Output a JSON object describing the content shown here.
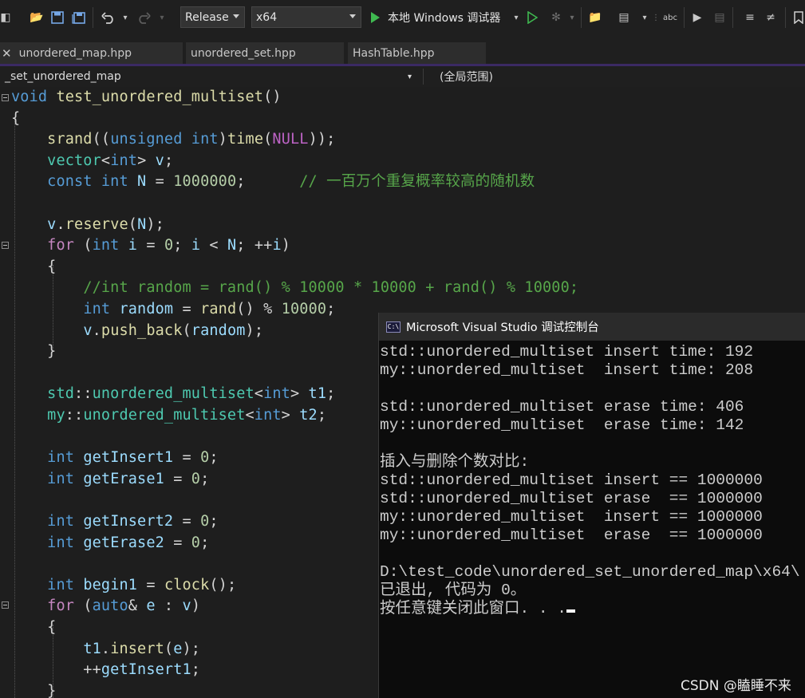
{
  "toolbar": {
    "config_value": "Release",
    "platform_value": "x64",
    "run_label": "本地 Windows 调试器"
  },
  "tabs": [
    "unordered_map.hpp",
    "unordered_set.hpp",
    "HashTable.hpp"
  ],
  "navbar": {
    "scope_left": "_set_unordered_map",
    "scope_right": "(全局范围)"
  },
  "code_lines": [
    [
      [
        "kw",
        "void"
      ],
      [
        "op",
        " "
      ],
      [
        "fn",
        "test_unordered_multiset"
      ],
      [
        "op",
        "()"
      ]
    ],
    [
      [
        "op",
        "{"
      ]
    ],
    [
      [
        "op",
        "    "
      ],
      [
        "fn",
        "srand"
      ],
      [
        "op",
        "(("
      ],
      [
        "kw",
        "unsigned int"
      ],
      [
        "op",
        ")"
      ],
      [
        "fn",
        "time"
      ],
      [
        "op",
        "("
      ],
      [
        "mac",
        "NULL"
      ],
      [
        "op",
        "));"
      ]
    ],
    [
      [
        "op",
        "    "
      ],
      [
        "ty",
        "vector"
      ],
      [
        "op",
        "<"
      ],
      [
        "kw",
        "int"
      ],
      [
        "op",
        "> "
      ],
      [
        "id",
        "v"
      ],
      [
        "op",
        ";"
      ]
    ],
    [
      [
        "op",
        "    "
      ],
      [
        "kw",
        "const int"
      ],
      [
        "op",
        " "
      ],
      [
        "id",
        "N"
      ],
      [
        "op",
        " = "
      ],
      [
        "num",
        "1000000"
      ],
      [
        "op",
        ";      "
      ],
      [
        "cm",
        "// 一百万个重复概率较高的随机数"
      ]
    ],
    [],
    [
      [
        "op",
        "    "
      ],
      [
        "id",
        "v"
      ],
      [
        "op",
        "."
      ],
      [
        "fn",
        "reserve"
      ],
      [
        "op",
        "("
      ],
      [
        "id",
        "N"
      ],
      [
        "op",
        ");"
      ]
    ],
    [
      [
        "op",
        "    "
      ],
      [
        "ctl",
        "for"
      ],
      [
        "op",
        " ("
      ],
      [
        "kw",
        "int"
      ],
      [
        "op",
        " "
      ],
      [
        "id",
        "i"
      ],
      [
        "op",
        " = "
      ],
      [
        "num",
        "0"
      ],
      [
        "op",
        "; "
      ],
      [
        "id",
        "i"
      ],
      [
        "op",
        " < "
      ],
      [
        "id",
        "N"
      ],
      [
        "op",
        "; ++"
      ],
      [
        "id",
        "i"
      ],
      [
        "op",
        ")"
      ]
    ],
    [
      [
        "op",
        "    {"
      ]
    ],
    [
      [
        "op",
        "        "
      ],
      [
        "cm",
        "//int random = rand() % 10000 * 10000 + rand() % 10000;"
      ]
    ],
    [
      [
        "op",
        "        "
      ],
      [
        "kw",
        "int"
      ],
      [
        "op",
        " "
      ],
      [
        "id",
        "random"
      ],
      [
        "op",
        " = "
      ],
      [
        "fn",
        "rand"
      ],
      [
        "op",
        "() % "
      ],
      [
        "num",
        "10000"
      ],
      [
        "op",
        ";"
      ]
    ],
    [
      [
        "op",
        "        "
      ],
      [
        "id",
        "v"
      ],
      [
        "op",
        "."
      ],
      [
        "fn",
        "push_back"
      ],
      [
        "op",
        "("
      ],
      [
        "id",
        "random"
      ],
      [
        "op",
        ");"
      ]
    ],
    [
      [
        "op",
        "    }"
      ]
    ],
    [],
    [
      [
        "op",
        "    "
      ],
      [
        "ty",
        "std"
      ],
      [
        "op",
        "::"
      ],
      [
        "ty",
        "unordered_multiset"
      ],
      [
        "op",
        "<"
      ],
      [
        "kw",
        "int"
      ],
      [
        "op",
        "> "
      ],
      [
        "id",
        "t1"
      ],
      [
        "op",
        ";"
      ]
    ],
    [
      [
        "op",
        "    "
      ],
      [
        "ty",
        "my"
      ],
      [
        "op",
        "::"
      ],
      [
        "ty",
        "unordered_multiset"
      ],
      [
        "op",
        "<"
      ],
      [
        "kw",
        "int"
      ],
      [
        "op",
        "> "
      ],
      [
        "id",
        "t2"
      ],
      [
        "op",
        ";"
      ]
    ],
    [],
    [
      [
        "op",
        "    "
      ],
      [
        "kw",
        "int"
      ],
      [
        "op",
        " "
      ],
      [
        "id",
        "getInsert1"
      ],
      [
        "op",
        " = "
      ],
      [
        "num",
        "0"
      ],
      [
        "op",
        ";"
      ]
    ],
    [
      [
        "op",
        "    "
      ],
      [
        "kw",
        "int"
      ],
      [
        "op",
        " "
      ],
      [
        "id",
        "getErase1"
      ],
      [
        "op",
        " = "
      ],
      [
        "num",
        "0"
      ],
      [
        "op",
        ";"
      ]
    ],
    [],
    [
      [
        "op",
        "    "
      ],
      [
        "kw",
        "int"
      ],
      [
        "op",
        " "
      ],
      [
        "id",
        "getInsert2"
      ],
      [
        "op",
        " = "
      ],
      [
        "num",
        "0"
      ],
      [
        "op",
        ";"
      ]
    ],
    [
      [
        "op",
        "    "
      ],
      [
        "kw",
        "int"
      ],
      [
        "op",
        " "
      ],
      [
        "id",
        "getErase2"
      ],
      [
        "op",
        " = "
      ],
      [
        "num",
        "0"
      ],
      [
        "op",
        ";"
      ]
    ],
    [],
    [
      [
        "op",
        "    "
      ],
      [
        "kw",
        "int"
      ],
      [
        "op",
        " "
      ],
      [
        "id",
        "begin1"
      ],
      [
        "op",
        " = "
      ],
      [
        "fn",
        "clock"
      ],
      [
        "op",
        "();"
      ]
    ],
    [
      [
        "op",
        "    "
      ],
      [
        "ctl",
        "for"
      ],
      [
        "op",
        " ("
      ],
      [
        "kw",
        "auto"
      ],
      [
        "op",
        "& "
      ],
      [
        "id",
        "e"
      ],
      [
        "op",
        " : "
      ],
      [
        "id",
        "v"
      ],
      [
        "op",
        ")"
      ]
    ],
    [
      [
        "op",
        "    {"
      ]
    ],
    [
      [
        "op",
        "        "
      ],
      [
        "id",
        "t1"
      ],
      [
        "op",
        "."
      ],
      [
        "fn",
        "insert"
      ],
      [
        "op",
        "("
      ],
      [
        "id",
        "e"
      ],
      [
        "op",
        ");"
      ]
    ],
    [
      [
        "op",
        "        ++"
      ],
      [
        "id",
        "getInsert1"
      ],
      [
        "op",
        ";"
      ]
    ],
    [
      [
        "op",
        "    }"
      ]
    ]
  ],
  "console": {
    "title": "Microsoft Visual Studio 调试控制台",
    "lines": [
      "std::unordered_multiset insert time: 192",
      "my::unordered_multiset  insert time: 208",
      "",
      "std::unordered_multiset erase time: 406",
      "my::unordered_multiset  erase time: 142",
      "",
      "插入与删除个数对比:",
      "std::unordered_multiset insert == 1000000",
      "std::unordered_multiset erase  == 1000000",
      "my::unordered_multiset  insert == 1000000",
      "my::unordered_multiset  erase  == 1000000",
      "",
      "D:\\test_code\\unordered_set_unordered_map\\x64\\",
      "已退出, 代码为 0。",
      "按任意键关闭此窗口. . ."
    ]
  },
  "watermark": "CSDN @瞌睡不来"
}
